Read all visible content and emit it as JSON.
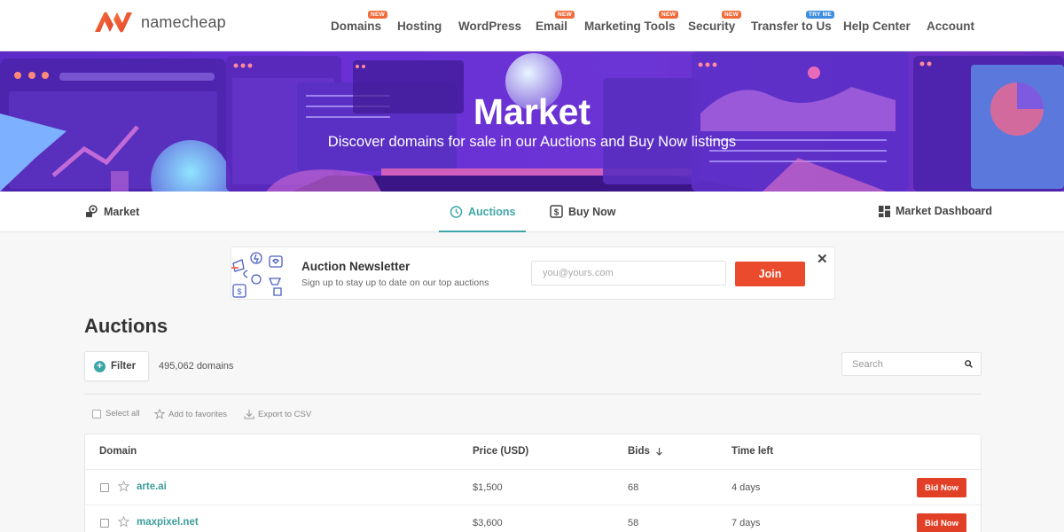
{
  "brand": {
    "name": "namecheap",
    "accent": "#ea4b2c",
    "teal": "#3ea6a6"
  },
  "nav": [
    {
      "label": "Domains",
      "badge": "NEW"
    },
    {
      "label": "Hosting",
      "badge": ""
    },
    {
      "label": "WordPress",
      "badge": ""
    },
    {
      "label": "Email",
      "badge": "NEW"
    },
    {
      "label": "Marketing Tools",
      "badge": "NEW"
    },
    {
      "label": "Security",
      "badge": "NEW"
    },
    {
      "label": "Transfer to Us",
      "badge": "TRY ME"
    },
    {
      "label": "Help Center",
      "badge": ""
    },
    {
      "label": "Account",
      "badge": ""
    }
  ],
  "hero": {
    "title": "Market",
    "subtitle": "Discover domains for sale in our Auctions and Buy Now listings"
  },
  "subnav": {
    "market": "Market",
    "auctions": "Auctions",
    "buy_now": "Buy Now",
    "dashboard": "Market Dashboard"
  },
  "newsletter": {
    "title": "Auction Newsletter",
    "subtitle": "Sign up to stay up to date on our top auctions",
    "placeholder": "you@yours.com",
    "join": "Join",
    "close": "✕"
  },
  "auctions": {
    "title": "Auctions",
    "filter": "Filter",
    "count": "495,062 domains",
    "search_placeholder": "Search",
    "select_all": "Select all",
    "add_favorites": "Add to favorites",
    "export_csv": "Export to CSV",
    "columns": {
      "domain": "Domain",
      "price": "Price (USD)",
      "bids": "Bids",
      "time": "Time left"
    },
    "rows": [
      {
        "domain": "arte.ai",
        "price": "$1,500",
        "bids": "68",
        "time": "4 days",
        "action": "Bid Now"
      },
      {
        "domain": "maxpixel.net",
        "price": "$3,600",
        "bids": "58",
        "time": "7 days",
        "action": "Bid Now"
      }
    ]
  }
}
